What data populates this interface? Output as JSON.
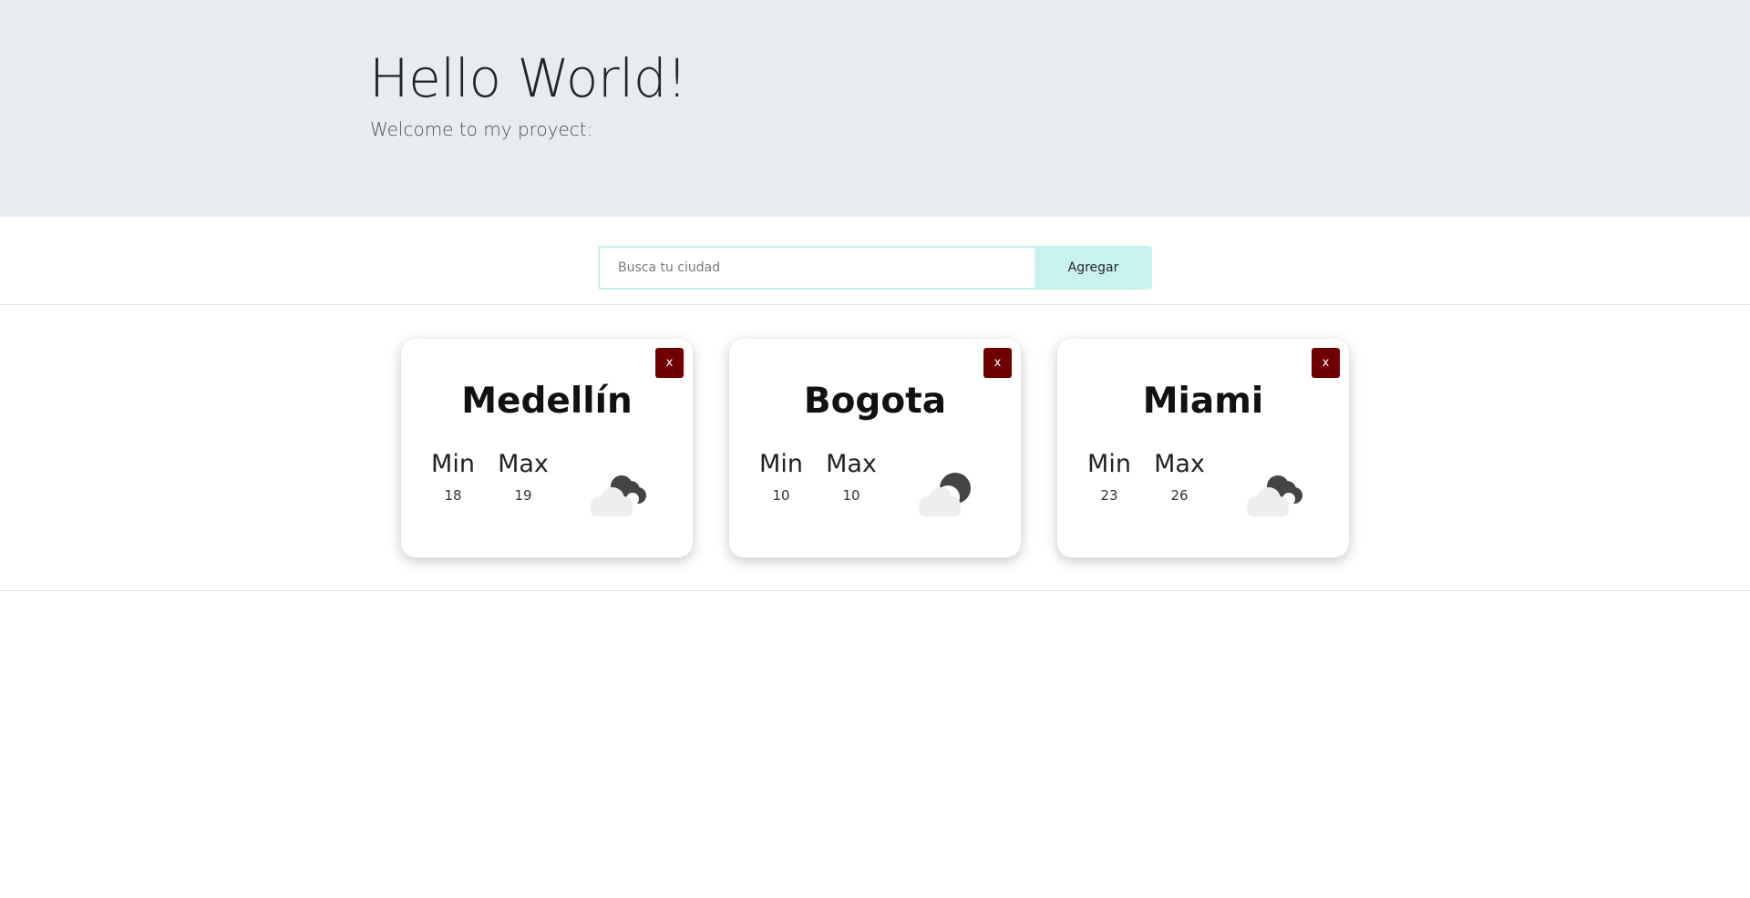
{
  "hero": {
    "title": "Hello World!",
    "subtitle": "Welcome to my proyect:"
  },
  "search": {
    "placeholder": "Busca tu ciudad",
    "value": "",
    "button_label": "Agregar"
  },
  "cards": [
    {
      "city": "Medellín",
      "min_label": "Min",
      "max_label": "Max",
      "min": "18",
      "max": "19",
      "close_label": "x",
      "icon": "cloud-moon-icon"
    },
    {
      "city": "Bogota",
      "min_label": "Min",
      "max_label": "Max",
      "min": "10",
      "max": "10",
      "close_label": "x",
      "icon": "cloud-moon-icon"
    },
    {
      "city": "Miami",
      "min_label": "Min",
      "max_label": "Max",
      "min": "23",
      "max": "26",
      "close_label": "x",
      "icon": "cloud-moon-icon"
    }
  ],
  "colors": {
    "hero_bg": "#e9ecef",
    "button_bg": "#c9f1ed",
    "close_bg": "#6f0000"
  }
}
